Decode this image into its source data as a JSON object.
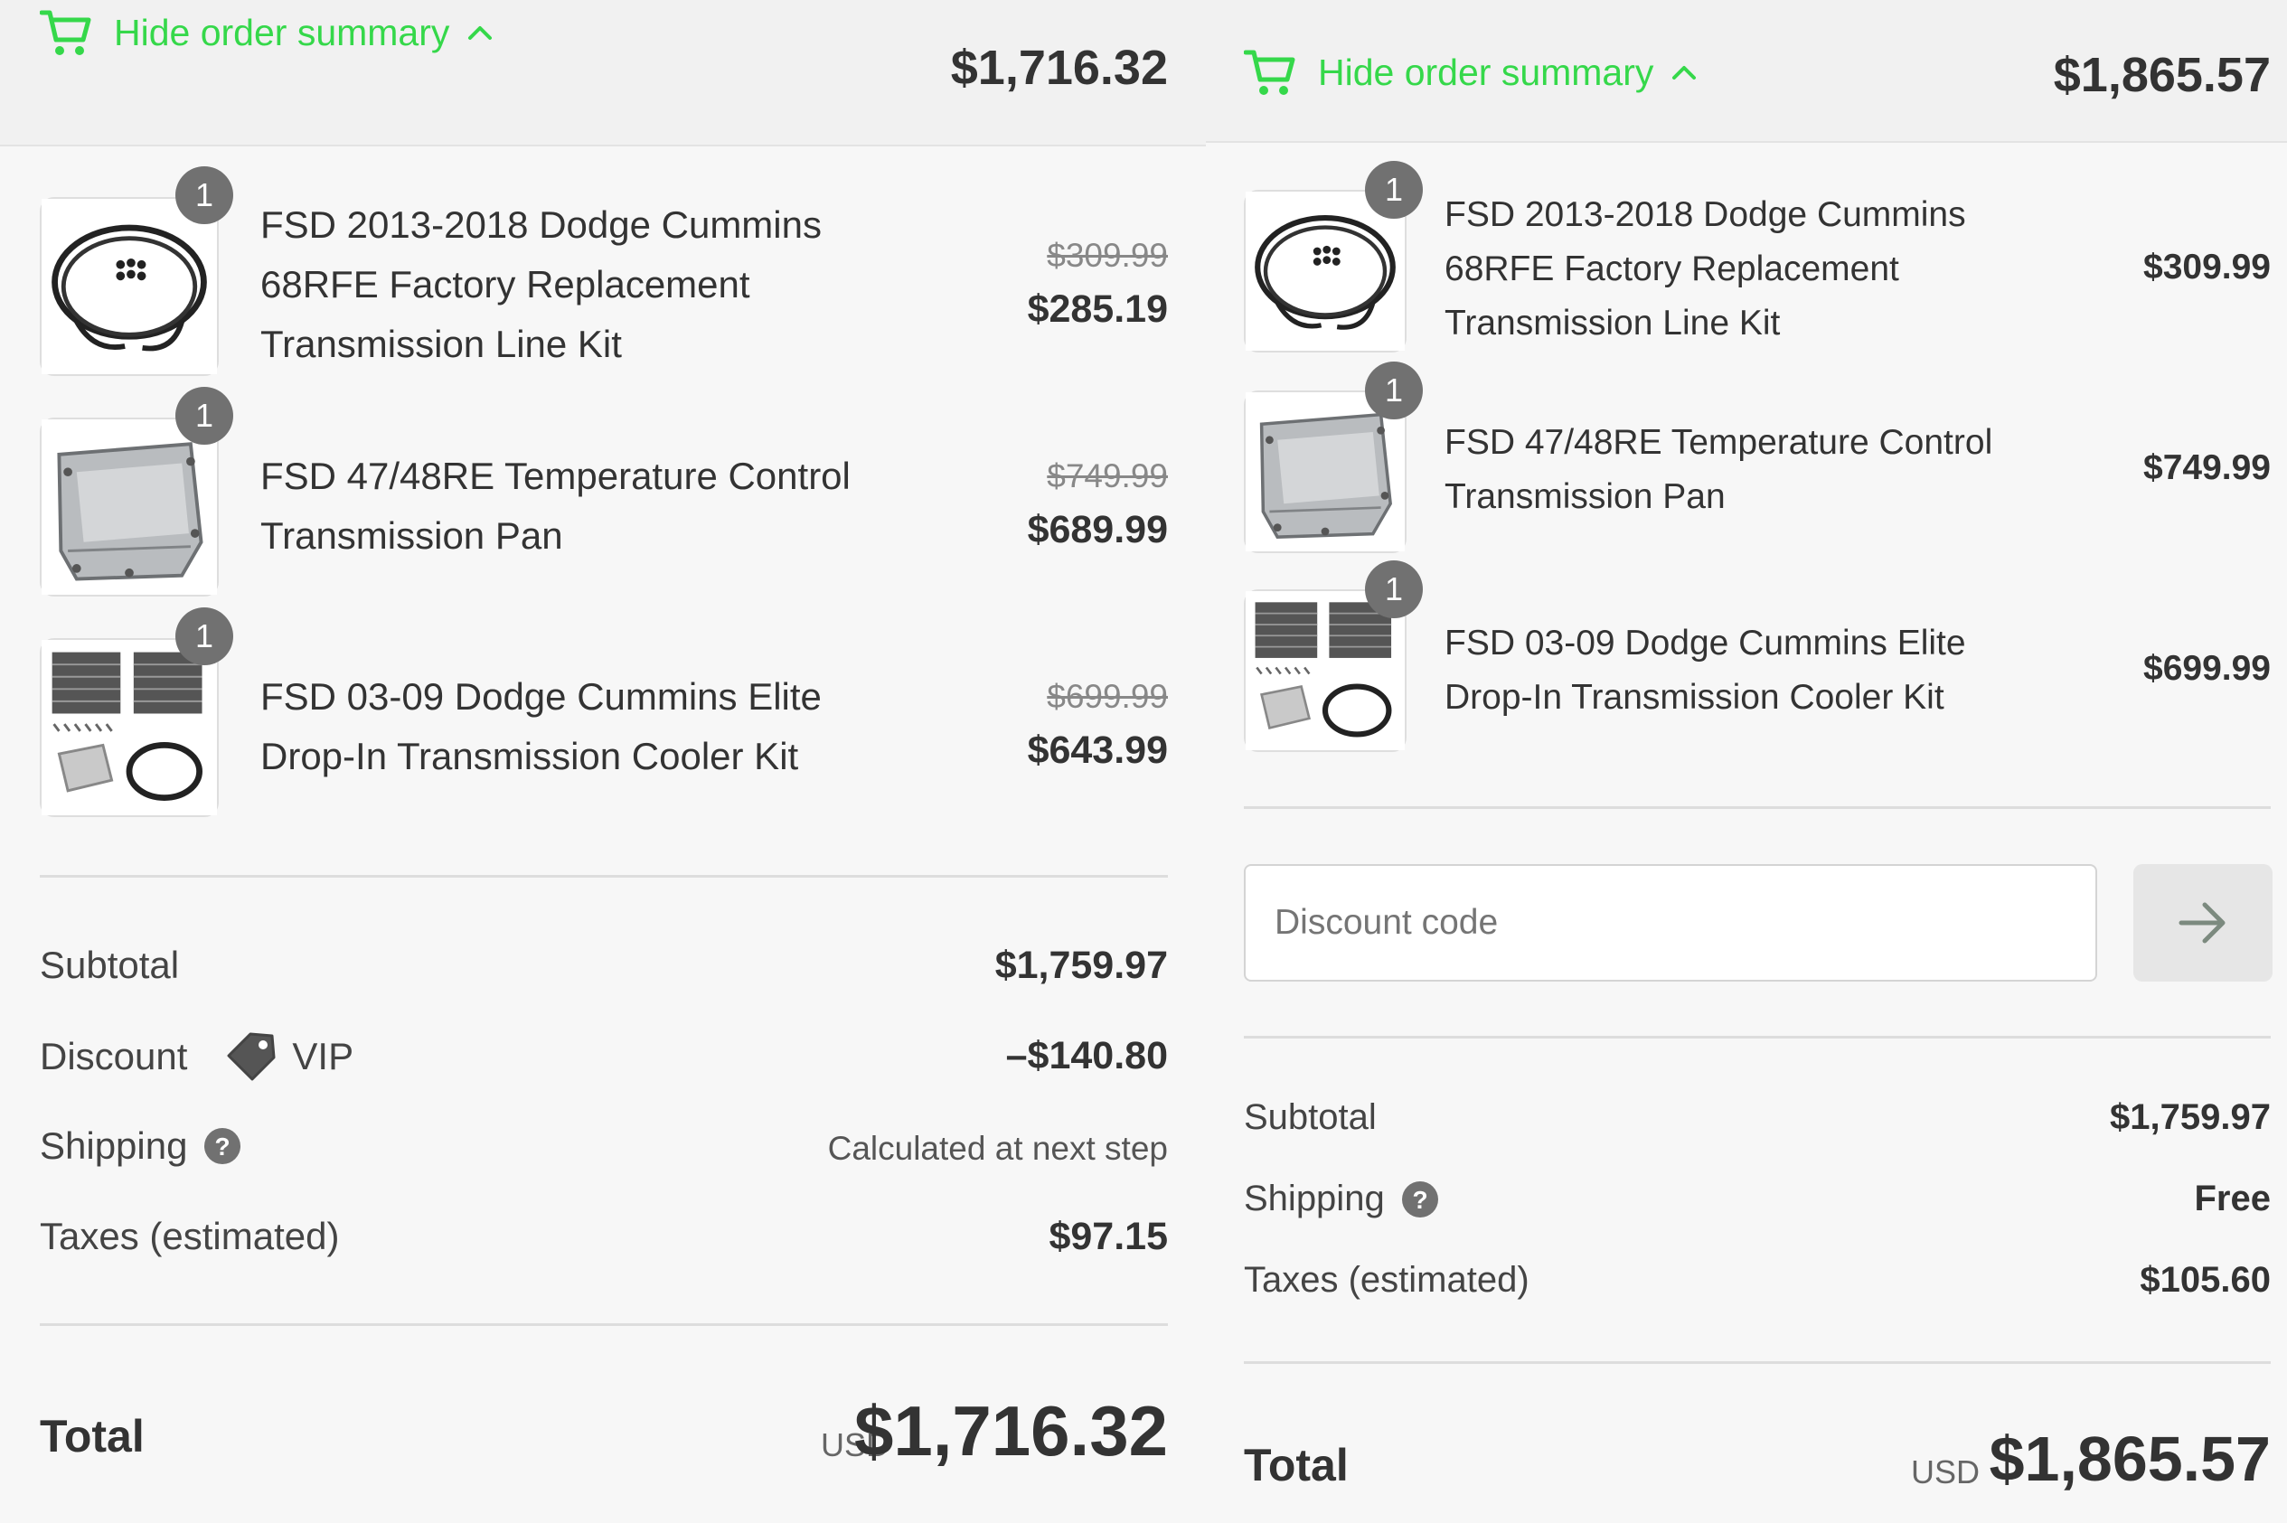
{
  "left": {
    "header": {
      "toggle_label": "Hide order summary",
      "total": "$1,716.32"
    },
    "items": [
      {
        "name_lines": [
          "FSD 2013-2018 Dodge Cummins",
          "68RFE Factory Replacement",
          "Transmission Line Kit"
        ],
        "qty": "1",
        "price_old": "$309.99",
        "price": "$285.19",
        "thumb": "hose-kit-icon"
      },
      {
        "name_lines": [
          "FSD 47/48RE Temperature Control",
          "Transmission Pan"
        ],
        "qty": "1",
        "price_old": "$749.99",
        "price": "$689.99",
        "thumb": "trans-pan-icon"
      },
      {
        "name_lines": [
          "FSD 03-09 Dodge Cummins Elite",
          "Drop-In Transmission Cooler Kit"
        ],
        "qty": "1",
        "price_old": "$699.99",
        "price": "$643.99",
        "thumb": "cooler-kit-icon"
      }
    ],
    "summary": {
      "subtotal_label": "Subtotal",
      "subtotal": "$1,759.97",
      "discount_label": "Discount",
      "discount_code": "VIP",
      "discount": "–$140.80",
      "shipping_label": "Shipping",
      "shipping": "Calculated at next step",
      "taxes_label": "Taxes (estimated)",
      "taxes": "$97.15"
    },
    "total": {
      "label": "Total",
      "currency": "USD",
      "amount": "$1,716.32"
    }
  },
  "right": {
    "header": {
      "toggle_label": "Hide order summary",
      "total": "$1,865.57"
    },
    "items": [
      {
        "name_lines": [
          "FSD 2013-2018 Dodge Cummins",
          "68RFE Factory Replacement",
          "Transmission Line Kit"
        ],
        "qty": "1",
        "price": "$309.99",
        "thumb": "hose-kit-icon"
      },
      {
        "name_lines": [
          "FSD 47/48RE Temperature Control",
          "Transmission Pan"
        ],
        "qty": "1",
        "price": "$749.99",
        "thumb": "trans-pan-icon"
      },
      {
        "name_lines": [
          "FSD 03-09 Dodge Cummins Elite",
          "Drop-In Transmission Cooler Kit"
        ],
        "qty": "1",
        "price": "$699.99",
        "thumb": "cooler-kit-icon"
      }
    ],
    "discount_field": {
      "placeholder": "Discount code"
    },
    "summary": {
      "subtotal_label": "Subtotal",
      "subtotal": "$1,759.97",
      "shipping_label": "Shipping",
      "shipping": "Free",
      "taxes_label": "Taxes (estimated)",
      "taxes": "$105.60"
    },
    "total": {
      "label": "Total",
      "currency": "USD",
      "amount": "$1,865.57"
    }
  },
  "colors": {
    "accent": "#35d84a",
    "badge": "#717171"
  }
}
